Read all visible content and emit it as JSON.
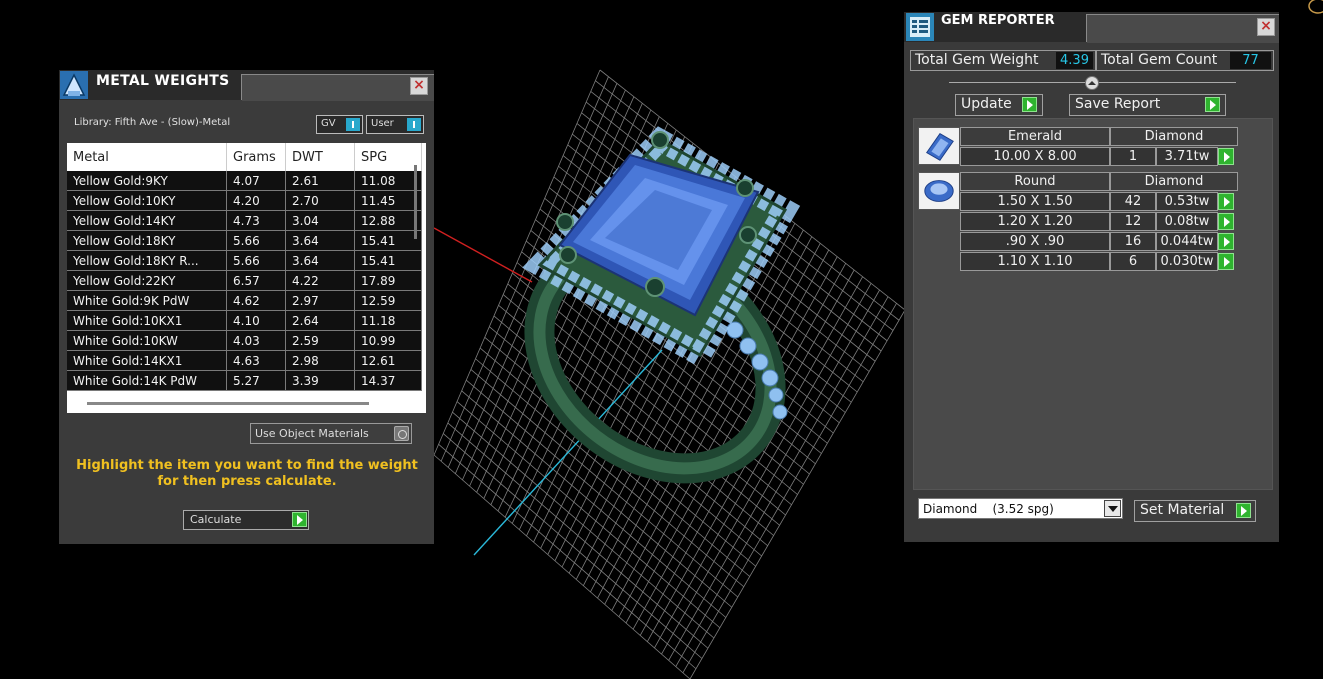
{
  "metal_weights": {
    "title": "METAL WEIGHTS",
    "library": "Library: Fifth Ave - (Slow)-Metal",
    "gv_label": "GV",
    "user_label": "User",
    "columns": [
      "Metal",
      "Grams",
      "DWT",
      "SPG"
    ],
    "rows": [
      [
        "Yellow Gold:9KY",
        "4.07",
        "2.61",
        "11.08"
      ],
      [
        "Yellow Gold:10KY",
        "4.20",
        "2.70",
        "11.45"
      ],
      [
        "Yellow Gold:14KY",
        "4.73",
        "3.04",
        "12.88"
      ],
      [
        "Yellow Gold:18KY",
        "5.66",
        "3.64",
        "15.41"
      ],
      [
        "Yellow Gold:18KY R...",
        "5.66",
        "3.64",
        "15.41"
      ],
      [
        "Yellow Gold:22KY",
        "6.57",
        "4.22",
        "17.89"
      ],
      [
        "White Gold:9K PdW",
        "4.62",
        "2.97",
        "12.59"
      ],
      [
        "White Gold:10KX1",
        "4.10",
        "2.64",
        "11.18"
      ],
      [
        "White Gold:10KW",
        "4.03",
        "2.59",
        "10.99"
      ],
      [
        "White Gold:14KX1",
        "4.63",
        "2.98",
        "12.61"
      ],
      [
        "White Gold:14K PdW",
        "5.27",
        "3.39",
        "14.37"
      ]
    ],
    "use_object_materials": "Use Object Materials",
    "hint": "Highlight the item you want to find the weight for then press calculate.",
    "calculate_label": "Calculate"
  },
  "gem_reporter": {
    "title": "GEM REPORTER",
    "total_weight_label": "Total Gem Weight",
    "total_weight": "4.39",
    "total_count_label": "Total Gem Count",
    "total_count": "77",
    "update_label": "Update",
    "save_label": "Save Report",
    "groups": [
      {
        "icon": "emerald-cut-gem-icon",
        "shape": "Emerald",
        "material": "Diamond",
        "rows": [
          {
            "size": "10.00 X 8.00",
            "count": "1",
            "weight": "3.71tw"
          }
        ]
      },
      {
        "icon": "round-gem-icon",
        "shape": "Round",
        "material": "Diamond",
        "rows": [
          {
            "size": "1.50 X 1.50",
            "count": "42",
            "weight": "0.53tw"
          },
          {
            "size": "1.20 X 1.20",
            "count": "12",
            "weight": "0.08tw"
          },
          {
            "size": ".90 X .90",
            "count": "16",
            "weight": "0.044tw"
          },
          {
            "size": "1.10 X 1.10",
            "count": "6",
            "weight": "0.030tw"
          }
        ]
      }
    ],
    "material_select": "Diamond    (3.52 spg)",
    "set_material_label": "Set Material"
  },
  "colors": {
    "panel_bg": "#3a3a3a",
    "value_cyan": "#27c6e6",
    "hint_yellow": "#f0c020",
    "play_green": "#2fb42f",
    "ring_metal": "#2e5a3f",
    "gem_blue": "#4a78d8",
    "grid_line": "#8a8a8a"
  }
}
